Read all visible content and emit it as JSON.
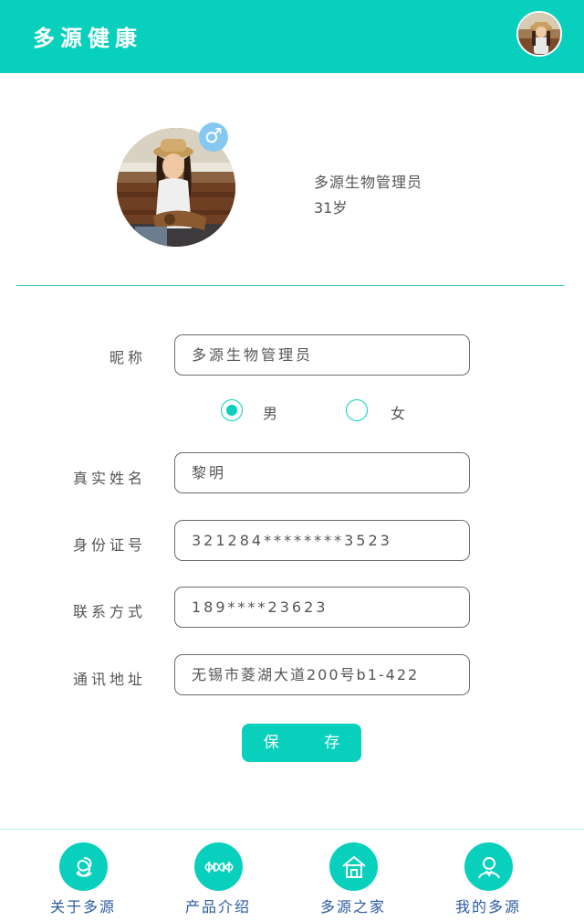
{
  "header": {
    "title": "多源健康"
  },
  "profile": {
    "name": "多源生物管理员",
    "age": "31岁",
    "gender_symbol": "♂"
  },
  "form": {
    "nickname_label": "昵称",
    "nickname_value": "多源生物管理员",
    "gender": {
      "male_label": "男",
      "female_label": "女",
      "selected": "男"
    },
    "realname_label": "真实姓名",
    "realname_value": "黎明",
    "id_label": "身份证号",
    "id_value": "321284********3523",
    "phone_label": "联系方式",
    "phone_value": "189****23623",
    "address_label": "通讯地址",
    "address_value": "无锡市菱湖大道200号b1-422",
    "save_label": "保 存"
  },
  "nav": [
    {
      "label": "关于多源",
      "icon": "knot-logo-icon"
    },
    {
      "label": "产品介绍",
      "icon": "dna-icon"
    },
    {
      "label": "多源之家",
      "icon": "home-icon"
    },
    {
      "label": "我的多源",
      "icon": "user-icon"
    }
  ],
  "colors": {
    "accent": "#08d0bc",
    "nav_text": "#2b5aa0",
    "badge": "#86c9f0"
  }
}
